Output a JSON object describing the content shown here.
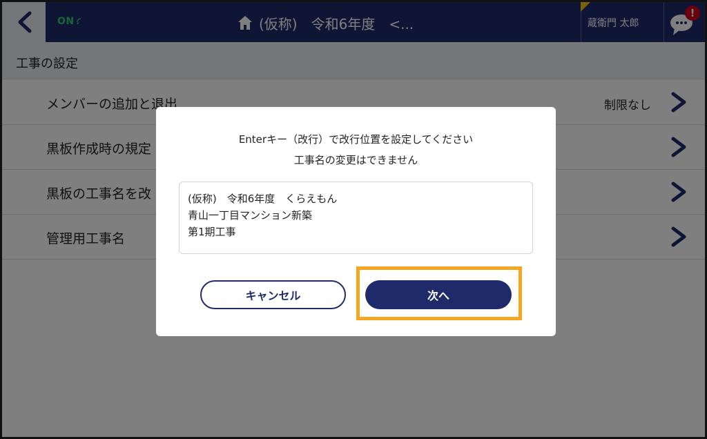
{
  "header": {
    "back_icon": "chevron-left-icon",
    "online_status": "ON",
    "title": "(仮称)　令和6年度　<...",
    "home_icon": "home-icon",
    "user_name": "蔵衛門 太郎",
    "chat_icon": "chat-bubble-icon",
    "alert_badge": "!"
  },
  "section": {
    "title": "工事の設定"
  },
  "list": [
    {
      "label": "メンバーの追加と退出",
      "value": "制限なし"
    },
    {
      "label": "黒板作成時の規定",
      "value": ""
    },
    {
      "label": "黒板の工事名を改",
      "value": ""
    },
    {
      "label": "管理用工事名",
      "value": ""
    }
  ],
  "dialog": {
    "line1": "Enterキー（改行）で改行位置を設定してください",
    "line2": "工事名の変更はできません",
    "textarea_lines": [
      "(仮称)　令和6年度　くらえもん",
      "青山一丁目マンション新築",
      "第1期工事"
    ],
    "cancel_label": "キャンセル",
    "next_label": "次へ"
  },
  "colors": {
    "navy": "#1f2a6b",
    "highlight": "#f5a623",
    "online_green": "#2ecc71",
    "alert_red": "#d0021b"
  }
}
